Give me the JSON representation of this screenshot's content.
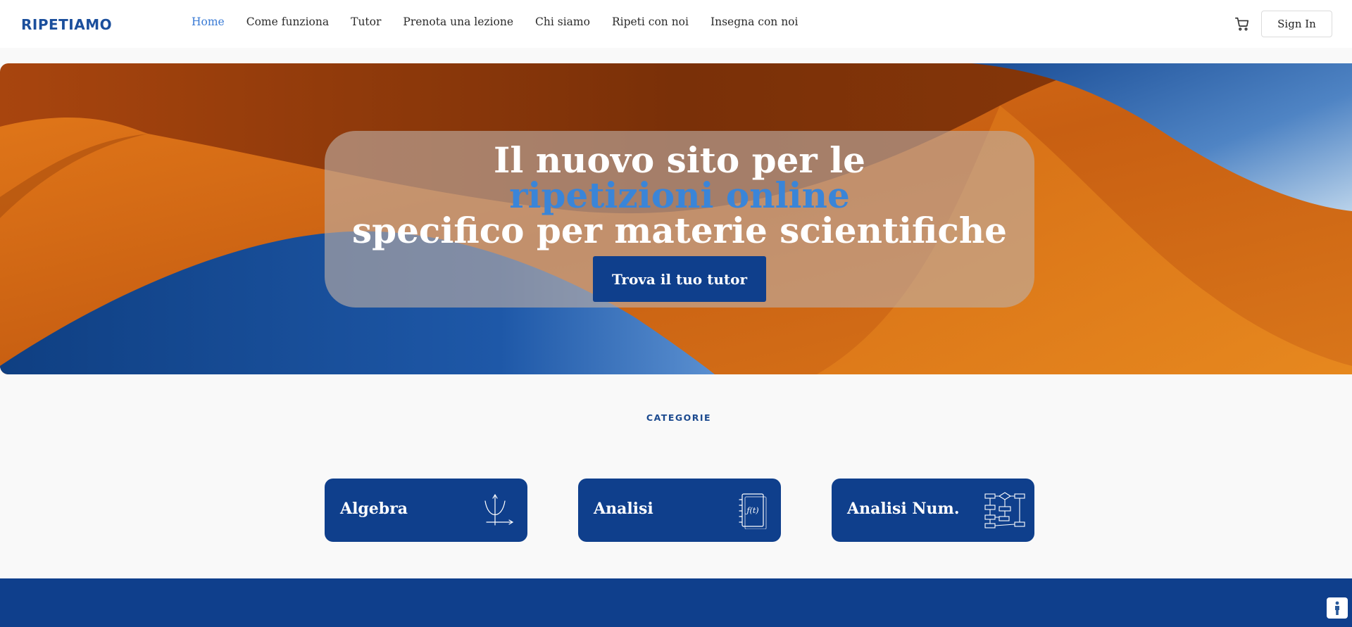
{
  "header": {
    "logo": "RIPETIAMO",
    "nav": [
      "Home",
      "Come funziona",
      "Tutor",
      "Prenota una lezione",
      "Chi siamo",
      "Ripeti con noi",
      "Insegna con noi"
    ],
    "active_nav": "Home",
    "sign_in_label": "Sign In",
    "cart_icon": "cart-icon"
  },
  "hero": {
    "line1": "Il nuovo sito per le",
    "line2": "ripetizioni online",
    "line3": "specifico per materie scientifiche",
    "cta_label": "Trova il tuo tutor"
  },
  "categories": {
    "title": "CATEGORIE",
    "items": [
      {
        "label": "Algebra",
        "icon": "parabola-graph-icon"
      },
      {
        "label": "Analisi",
        "icon": "function-book-icon"
      },
      {
        "label": "Analisi Num.",
        "icon": "flowchart-icon"
      }
    ]
  },
  "colors": {
    "brand_blue": "#0f3f8c",
    "accent_blue": "#3a85d8",
    "hero_orange": "#d36a14"
  }
}
